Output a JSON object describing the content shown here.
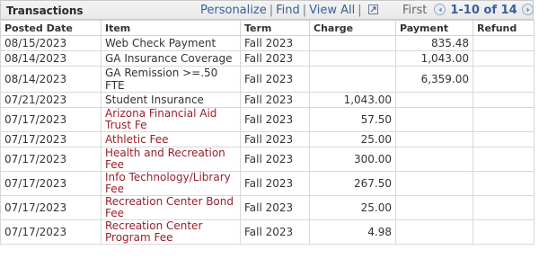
{
  "grid": {
    "title": "Transactions",
    "links": {
      "personalize": "Personalize",
      "find": "Find",
      "view_all": "View All",
      "sep": "|"
    },
    "nav": {
      "first": "First",
      "range": "1-10 of 14"
    }
  },
  "columns": [
    "Posted Date",
    "Item",
    "Term",
    "Charge",
    "Payment",
    "Refund"
  ],
  "rows": [
    {
      "date": "08/15/2023",
      "item": "Web Check Payment",
      "term": "Fall 2023",
      "charge": "",
      "payment": "835.48",
      "refund": ""
    },
    {
      "date": "08/14/2023",
      "item": "GA Insurance Coverage",
      "term": "Fall 2023",
      "charge": "",
      "payment": "1,043.00",
      "refund": ""
    },
    {
      "date": "08/14/2023",
      "item": "GA Remission >=.50 FTE",
      "term": "Fall 2023",
      "charge": "",
      "payment": "6,359.00",
      "refund": ""
    },
    {
      "date": "07/21/2023",
      "item": "Student Insurance",
      "term": "Fall 2023",
      "charge": "1,043.00",
      "payment": "",
      "refund": ""
    },
    {
      "date": "07/17/2023",
      "item": "Arizona Financial Aid Trust Fe",
      "term": "Fall 2023",
      "charge": "57.50",
      "payment": "",
      "refund": ""
    },
    {
      "date": "07/17/2023",
      "item": "Athletic Fee",
      "term": "Fall 2023",
      "charge": "25.00",
      "payment": "",
      "refund": ""
    },
    {
      "date": "07/17/2023",
      "item": "Health and Recreation Fee",
      "term": "Fall 2023",
      "charge": "300.00",
      "payment": "",
      "refund": ""
    },
    {
      "date": "07/17/2023",
      "item": "Info Technology/Library Fee",
      "term": "Fall 2023",
      "charge": "267.50",
      "payment": "",
      "refund": ""
    },
    {
      "date": "07/17/2023",
      "item": "Recreation Center Bond Fee",
      "term": "Fall 2023",
      "charge": "25.00",
      "payment": "",
      "refund": ""
    },
    {
      "date": "07/17/2023",
      "item": "Recreation Center Program Fee",
      "term": "Fall 2023",
      "charge": "4.98",
      "payment": "",
      "refund": ""
    }
  ],
  "icons": {
    "popout": "popout-icon",
    "prev": "previous-arrow-icon",
    "next": "next-arrow-icon"
  },
  "colors": {
    "link": "#3a5f9a",
    "item_link": "#9a1f2a"
  }
}
